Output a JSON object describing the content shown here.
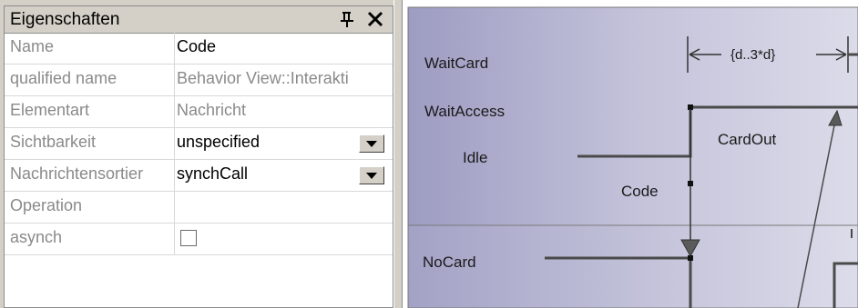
{
  "panel": {
    "title": "Eigenschaften",
    "pin_icon": "pin-icon",
    "close_icon": "close-icon"
  },
  "properties": [
    {
      "name": "Name",
      "value": "Code"
    },
    {
      "name": "qualified name",
      "value": "Behavior View::Interakti"
    },
    {
      "name": "Elementart",
      "value": "Nachricht"
    },
    {
      "name": "Sichtbarkeit",
      "value": "unspecified"
    },
    {
      "name": "Nachrichtensortier",
      "value": "synchCall"
    },
    {
      "name": "Operation",
      "value": ""
    },
    {
      "name": "asynch",
      "value": ""
    }
  ],
  "diagram": {
    "states_upper": [
      "WaitCard",
      "WaitAccess",
      "Idle"
    ],
    "states_lower": [
      "NoCard"
    ],
    "constraint": "{d..3*d}",
    "message_code": "Code",
    "message_cardout": "CardOut",
    "colors": {
      "lifeline_top": "#d4d3e4",
      "lifeline_bottom": "#a9a8c8",
      "line": "#4a4a4a"
    }
  }
}
